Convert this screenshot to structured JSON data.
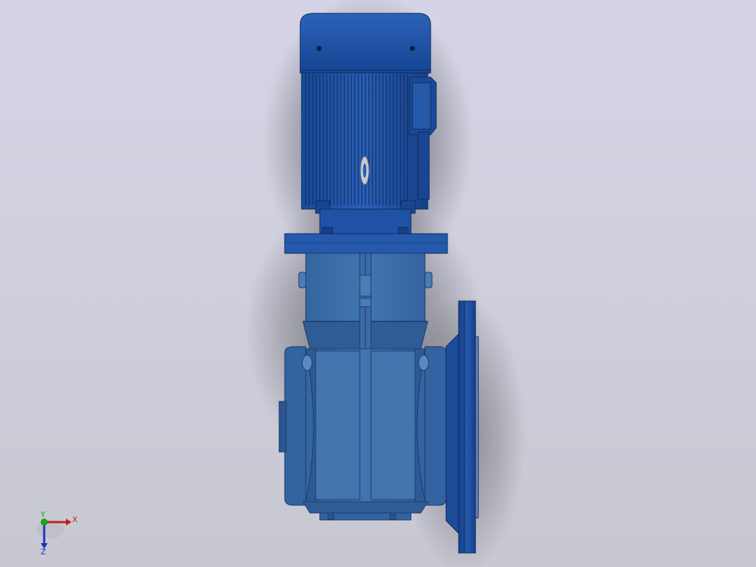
{
  "viewport": {
    "background_top": "#d4d4e6",
    "background_bottom": "#c8c8d2"
  },
  "model": {
    "motor_color": "#1d4f9e",
    "motor_dark": "#123a7a",
    "gearbox_color": "#3a6aa4",
    "gearbox_dark": "#2a5389",
    "flange_color": "#1e4e9c"
  },
  "triad": {
    "x_label": "X",
    "y_label": "Y",
    "z_label": "Z",
    "x_color": "#c02020",
    "y_color": "#20a020",
    "z_color": "#2030c0"
  }
}
